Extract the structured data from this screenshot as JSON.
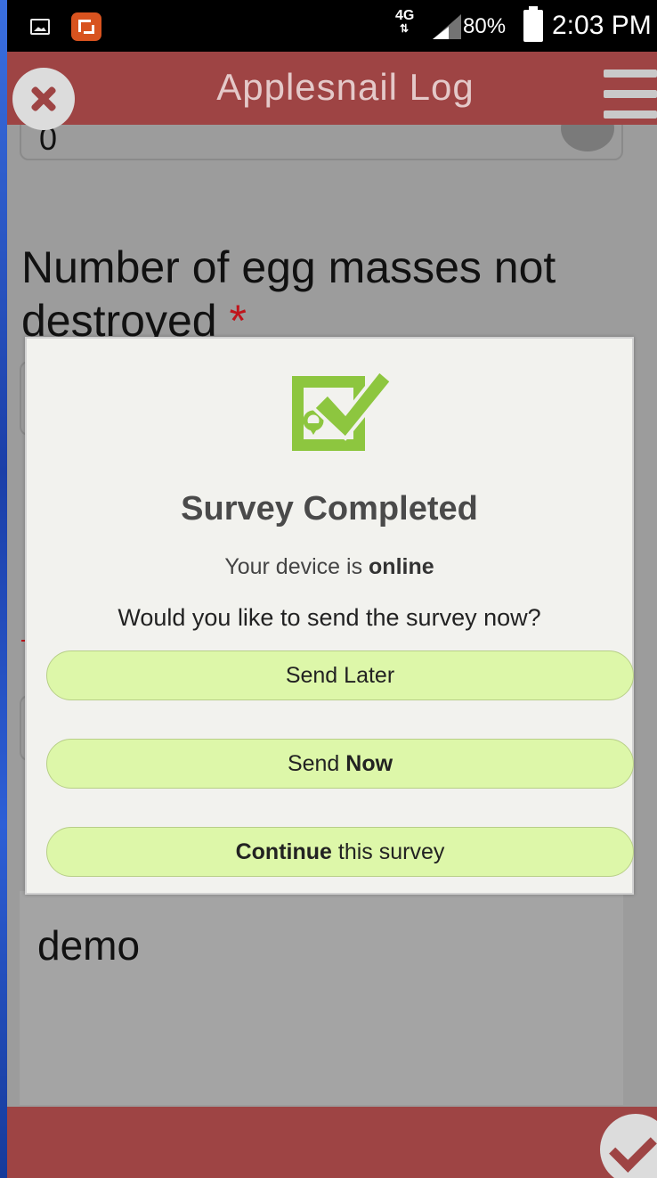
{
  "status_bar": {
    "network": "4G",
    "battery": "80%",
    "time": "2:03 PM"
  },
  "app_bar": {
    "title": "Applesnail Log"
  },
  "form": {
    "previous_value": "0",
    "question_label": "Number of egg masses not destroyed",
    "required_marker": "*",
    "notes_value": "demo"
  },
  "dialog": {
    "title": "Survey Completed",
    "status_prefix": "Your device is",
    "status_value": "online",
    "question": "Would you like to send the survey now?",
    "send_later": "Send Later",
    "send_now_prefix": "Send",
    "send_now_bold": "Now",
    "continue_bold": "Continue",
    "continue_suffix": "this survey"
  },
  "colors": {
    "app_bar": "#9e4444",
    "dialog_button": "#ddf7a9",
    "icon_green": "#8dc63f",
    "required": "#c0141b"
  }
}
